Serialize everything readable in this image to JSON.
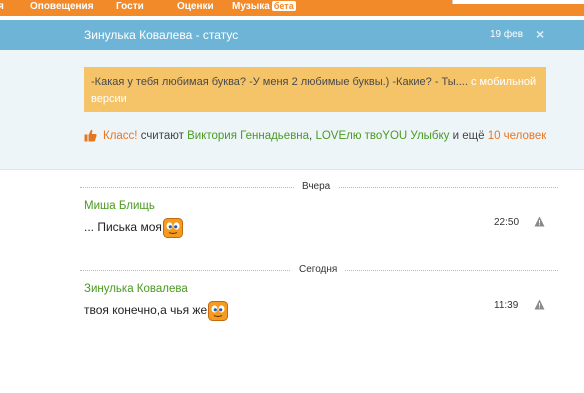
{
  "topnav": {
    "items": [
      "я",
      "Оповещения",
      "Гости",
      "Оценки",
      "Музыка"
    ],
    "beta": "бета"
  },
  "status": {
    "title": "Зинулька Ковалева - статус",
    "date": "19 фев",
    "close_icon": "×",
    "text": "-Какая у тебя любимая буква? -У меня 2 любимые буквы.) -Какие? - Ты....",
    "mobile_link": "с мобильной версии",
    "like": {
      "klass": "Класс!",
      "considers": " считают ",
      "user1": "Виктория Геннадьевна",
      "comma": ", ",
      "user2": "LOVEлю твоYOU Улыбку",
      "and_more": " и ещё ",
      "more_count": "10 человек"
    }
  },
  "days": [
    {
      "label": "Вчера"
    },
    {
      "label": "Сегодня"
    }
  ],
  "messages": [
    {
      "author": "Миша Блищь",
      "text": "... Писька моя",
      "time": "22:50"
    },
    {
      "author": "Зинулька Ковалева",
      "text": "твоя конечно,а чья же",
      "time": "11:39"
    }
  ],
  "colors": {
    "nav": "#f28a2a",
    "header": "#6db4d6",
    "bubble": "#f5c469",
    "link_orange": "#e77620",
    "link_green": "#4a9a21"
  }
}
